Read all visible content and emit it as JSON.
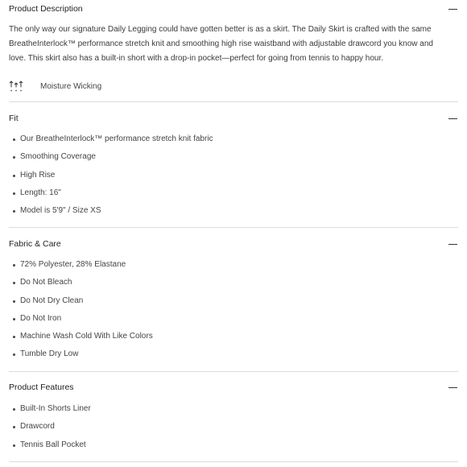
{
  "description_section": {
    "title": "Product Description",
    "text": "The only way our signature Daily Legging could have gotten better is as a skirt. The Daily Skirt is crafted with the same BreatheInterlock™ performance stretch knit and smoothing high rise waistband with adjustable drawcord you know and love. This skirt also has a built-in short with a drop-in pocket—perfect for going from tennis to happy hour.",
    "feature": {
      "icon": "moisture-wicking-icon",
      "label": "Moisture Wicking"
    }
  },
  "fit_section": {
    "title": "Fit",
    "items": [
      "Our BreatheInterlock™ performance stretch knit fabric",
      "Smoothing Coverage",
      "High Rise",
      "Length: 16\"",
      "Model is 5'9\" / Size XS"
    ]
  },
  "fabric_section": {
    "title": "Fabric & Care",
    "items": [
      "72% Polyester, 28% Elastane",
      "Do Not Bleach",
      "Do Not Dry Clean",
      "Do Not Iron",
      "Machine Wash Cold With Like Colors",
      "Tumble Dry Low"
    ]
  },
  "features_section": {
    "title": "Product Features",
    "items": [
      "Built-In Shorts Liner",
      "Drawcord",
      "Tennis Ball Pocket"
    ]
  }
}
